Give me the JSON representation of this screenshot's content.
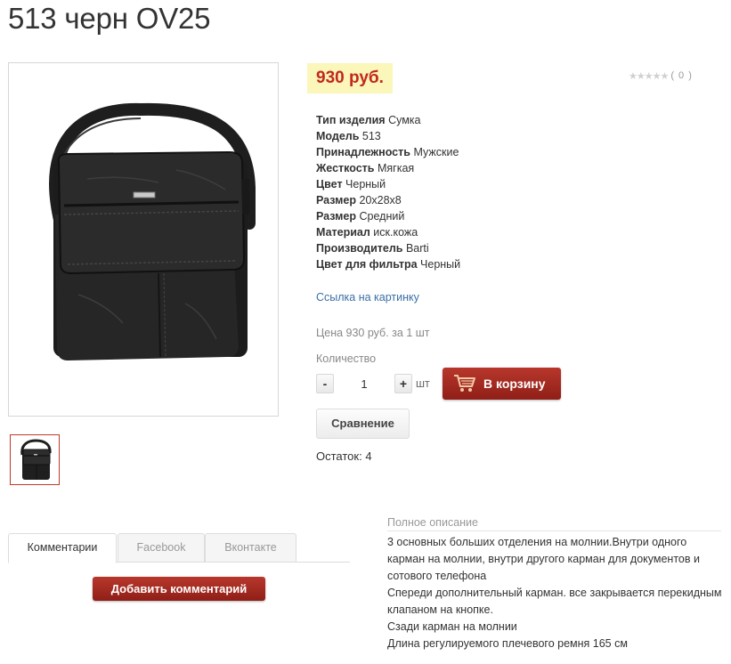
{
  "product": {
    "title": "513 черн OV25",
    "price": "930 руб.",
    "rating_count": "( 0 )",
    "properties": [
      {
        "key": "Тип изделия",
        "value": "Сумка"
      },
      {
        "key": "Модель",
        "value": "513"
      },
      {
        "key": "Принадлежность",
        "value": "Мужские"
      },
      {
        "key": "Жесткость",
        "value": "Мягкая"
      },
      {
        "key": "Цвет",
        "value": "Черный"
      },
      {
        "key": "Размер",
        "value": "20x28x8"
      },
      {
        "key": "Размер",
        "value": "Средний"
      },
      {
        "key": "Материал",
        "value": "иск.кожа"
      },
      {
        "key": "Производитель",
        "value": "Barti"
      },
      {
        "key": "Цвет для фильтра",
        "value": "Черный"
      }
    ],
    "image_link": "Ссылка на картинку",
    "price_per_unit": "Цена 930 руб. за 1 шт",
    "quantity_label": "Количество",
    "quantity_value": "1",
    "quantity_minus": "-",
    "quantity_plus": "+",
    "quantity_unit": "шт",
    "add_to_cart": "В корзину",
    "compare": "Сравнение",
    "stock": "Остаток: 4"
  },
  "tabs": [
    {
      "label": "Комментарии",
      "active": true
    },
    {
      "label": "Facebook",
      "active": false
    },
    {
      "label": "Вконтакте",
      "active": false
    }
  ],
  "add_comment": "Добавить комментарий",
  "description": {
    "title": "Полное описание",
    "lines": [
      "3 основных больших отделения на молнии.Внутри одного карман на молнии, внутри другого карман для документов и сотового телефона",
      "Спереди дополнительный карман. все закрывается перекидным клапаном на кнопке.",
      "Сзади карман на молнии",
      "Длина регулируемого плечевого ремня 165 см"
    ]
  },
  "colors": {
    "price_bg": "#fbf6ba",
    "price_text": "#c2281d",
    "button_primary": "#a72c22",
    "link": "#3a6fa8"
  }
}
